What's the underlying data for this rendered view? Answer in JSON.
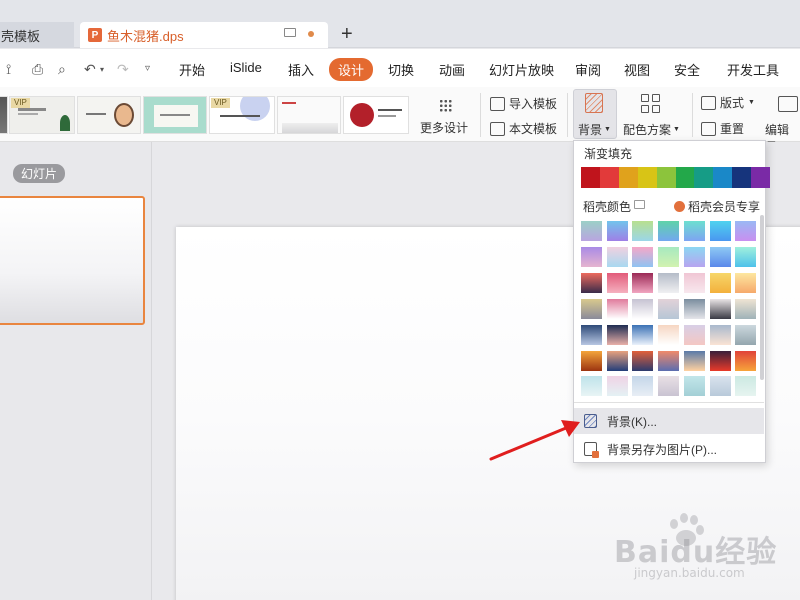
{
  "tabs": {
    "inactive_label": "稻壳模板",
    "active_label": "鱼木混猪.dps",
    "file_icon_letter": "P",
    "new_tab_symbol": "+"
  },
  "menu": {
    "items": [
      {
        "id": "start",
        "label": "开始"
      },
      {
        "id": "islide",
        "label": "iSlide"
      },
      {
        "id": "insert",
        "label": "插入"
      },
      {
        "id": "design",
        "label": "设计",
        "active": true
      },
      {
        "id": "transition",
        "label": "切换"
      },
      {
        "id": "animation",
        "label": "动画"
      },
      {
        "id": "slideshow",
        "label": "幻灯片放映"
      },
      {
        "id": "review",
        "label": "审阅"
      },
      {
        "id": "view",
        "label": "视图"
      },
      {
        "id": "security",
        "label": "安全"
      },
      {
        "id": "developer",
        "label": "开发工具"
      }
    ]
  },
  "ribbon": {
    "vip_badge": "VIP",
    "more_designs": "更多设计",
    "import_template": "导入模板",
    "text_template": "本文模板",
    "background": "背景",
    "color_scheme": "配色方案",
    "layout": "版式",
    "reset": "重置",
    "edit_master": "编辑母"
  },
  "sidebar": {
    "slides_label": "幻灯片"
  },
  "dropdown": {
    "gradient_fill_heading": "渐变填充",
    "docer_colors_heading": "稻壳颜色",
    "member_exclusive": "稻壳会员专享",
    "background_item": "背景(K)...",
    "save_bg_as_image_item": "背景另存为图片(P)...",
    "solid_colors": [
      "#c0141c",
      "#e23a3a",
      "#e0a21c",
      "#d8c416",
      "#8cc43c",
      "#23a84a",
      "#169c86",
      "#1a88c8",
      "#16347c",
      "#7a2aa6"
    ]
  },
  "watermark": {
    "brand": "Baidu经验",
    "url": "jingyan.baidu.com"
  },
  "colors": {
    "accent": "#e46a30",
    "arrow": "#e01e1e"
  }
}
